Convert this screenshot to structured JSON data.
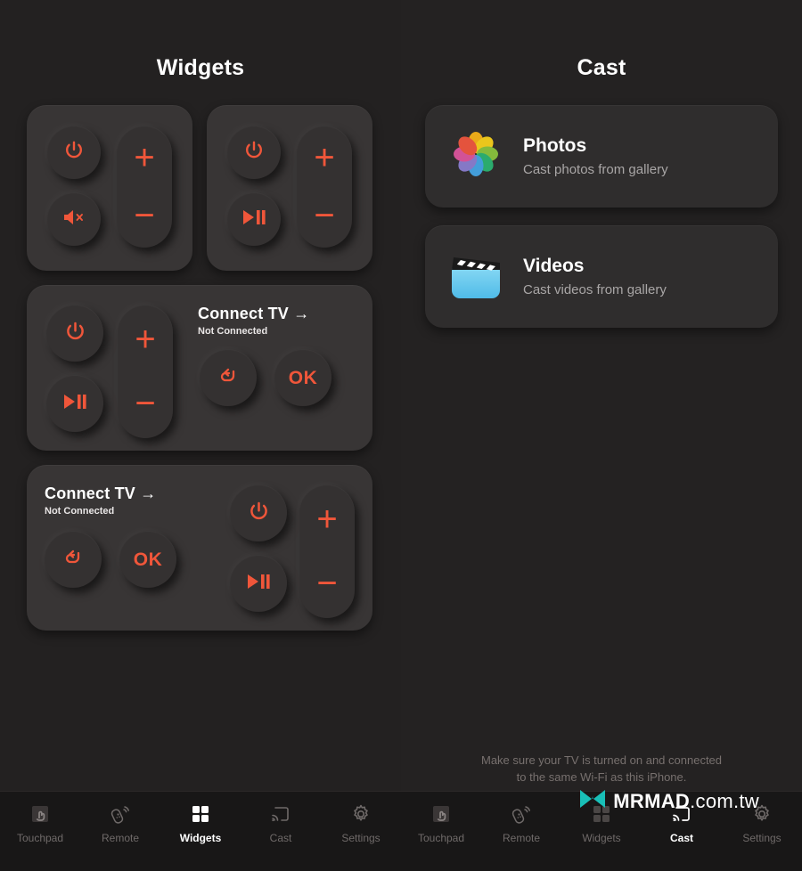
{
  "theme": {
    "accent": "#f0563a",
    "bg": "#232121",
    "card": "#383535",
    "logo_teal": "#19bfb7"
  },
  "left_pane": {
    "title": "Widgets",
    "widgets": [
      {
        "name": "power-mute-volume",
        "buttons": [
          "power-icon",
          "mute-icon",
          "plus",
          "minus"
        ]
      },
      {
        "name": "power-playpause-volume",
        "buttons": [
          "power-icon",
          "play-pause-icon",
          "plus",
          "minus"
        ]
      },
      {
        "name": "connect-tv-right",
        "connect_title": "Connect TV →",
        "connect_status": "Not Connected",
        "ok_label": "OK"
      },
      {
        "name": "connect-tv-left",
        "connect_title": "Connect TV →",
        "connect_status": "Not Connected",
        "ok_label": "OK"
      }
    ]
  },
  "right_pane": {
    "title": "Cast",
    "cards": [
      {
        "icon": "photos-icon",
        "title": "Photos",
        "subtitle": "Cast photos from gallery"
      },
      {
        "icon": "videos-icon",
        "title": "Videos",
        "subtitle": "Cast videos from gallery"
      }
    ],
    "footnote_line1": "Make sure your TV is turned on and connected",
    "footnote_line2": "to the same Wi-Fi as this iPhone."
  },
  "tabs_left": [
    {
      "label": "Touchpad",
      "icon": "touchpad-icon",
      "active": false
    },
    {
      "label": "Remote",
      "icon": "remote-icon",
      "active": false
    },
    {
      "label": "Widgets",
      "icon": "widgets-icon",
      "active": true
    },
    {
      "label": "Cast",
      "icon": "cast-icon",
      "active": false
    },
    {
      "label": "Settings",
      "icon": "gear-icon",
      "active": false
    }
  ],
  "tabs_right": [
    {
      "label": "Touchpad",
      "icon": "touchpad-icon",
      "active": false
    },
    {
      "label": "Remote",
      "icon": "remote-icon",
      "active": false
    },
    {
      "label": "Widgets",
      "icon": "widgets-icon",
      "active": false
    },
    {
      "label": "Cast",
      "icon": "cast-icon",
      "active": true
    },
    {
      "label": "Settings",
      "icon": "gear-icon",
      "active": false
    }
  ],
  "watermark": {
    "bold": "MRMAD",
    "light": ".com.tw"
  }
}
